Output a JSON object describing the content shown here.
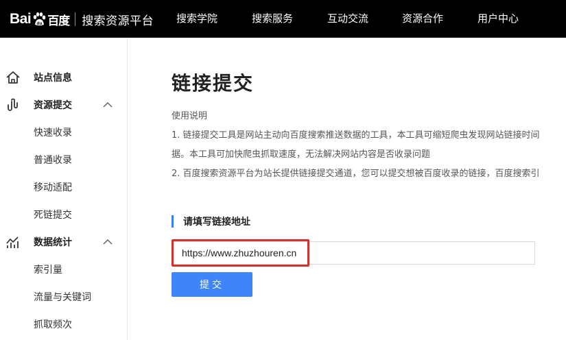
{
  "header": {
    "logo_text_latin": "Bai",
    "logo_text_cn": "百度",
    "platform_name": "搜索资源平台",
    "nav": [
      {
        "label": "搜索学院"
      },
      {
        "label": "搜索服务"
      },
      {
        "label": "互动交流"
      },
      {
        "label": "资源合作"
      },
      {
        "label": "用户中心"
      }
    ]
  },
  "sidebar": {
    "groups": [
      {
        "label": "站点信息",
        "icon": "home-icon"
      },
      {
        "label": "资源提交",
        "icon": "link-submit-icon",
        "expanded": true,
        "items": [
          {
            "label": "快速收录"
          },
          {
            "label": "普通收录"
          },
          {
            "label": "移动适配"
          },
          {
            "label": "死链提交"
          }
        ]
      },
      {
        "label": "数据统计",
        "icon": "stats-icon",
        "expanded": true,
        "items": [
          {
            "label": "索引量"
          },
          {
            "label": "流量与关键词"
          },
          {
            "label": "抓取频次"
          }
        ]
      }
    ]
  },
  "main": {
    "title": "链接提交",
    "usage_heading": "使用说明",
    "desc_lines": [
      "1. 链接提交工具是网站主动向百度搜索推送数据的工具，本工具可缩短爬虫发现网站链接时间",
      "据。本工具可加快爬虫抓取速度，无法解决网站内容是否收录问题",
      "2. 百度搜索资源平台为站长提供链接提交通道，您可以提交想被百度收录的链接，百度搜索引"
    ],
    "section_label": "请填写链接地址",
    "url_value": "https://www.zhuzhouren.cn",
    "submit_label": "提交"
  },
  "colors": {
    "topbar": "#000000",
    "accent": "#3f84f8",
    "highlight": "#d0322e"
  }
}
